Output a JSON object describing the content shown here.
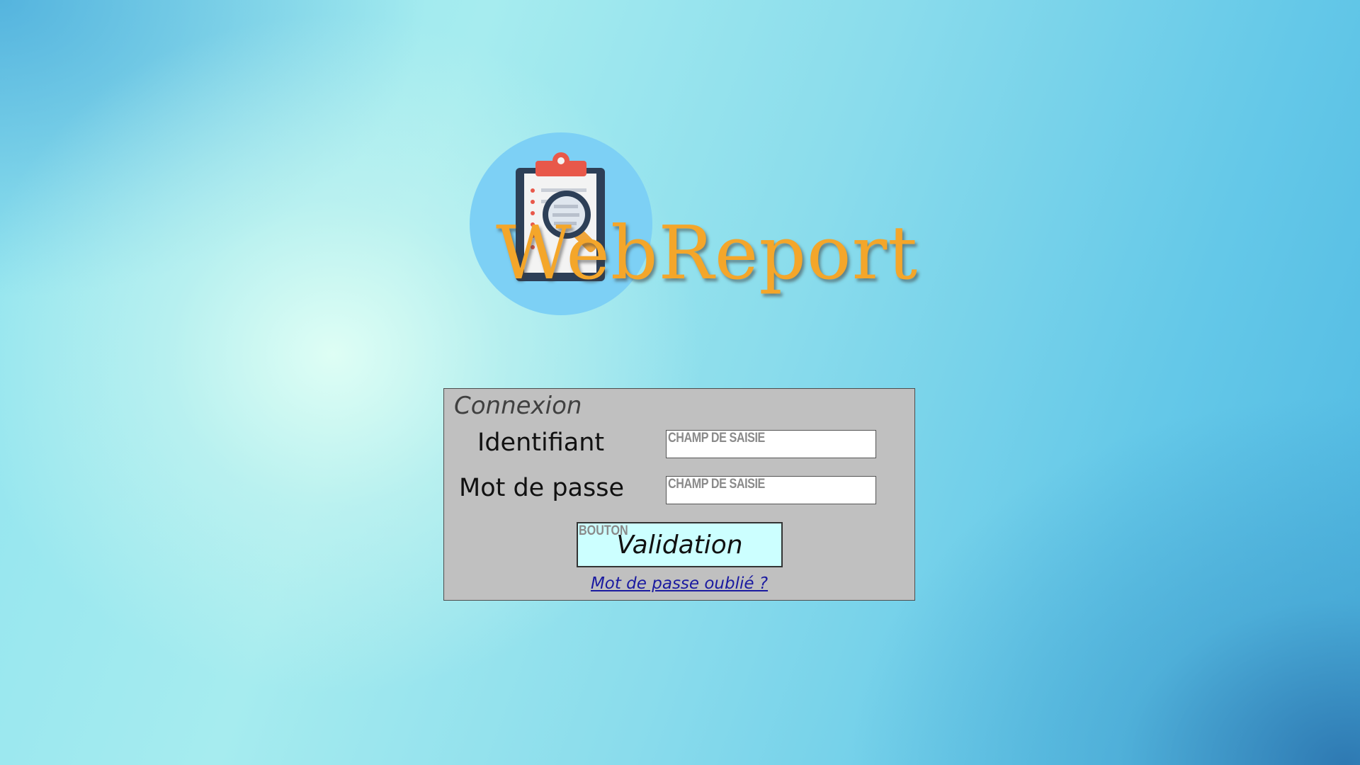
{
  "app": {
    "logo_text": "WebReport"
  },
  "login": {
    "title": "Connexion",
    "username_label": "Identifiant",
    "username_placeholder": "CHAMP DE SAISIE",
    "password_label": "Mot de passe",
    "password_placeholder": "CHAMP DE SAISIE",
    "submit_tag": "BOUTON",
    "submit_label": "Validation",
    "forgot_link": "Mot de passe oublié ?"
  },
  "icons": {
    "logo": "clipboard-magnifier-icon"
  },
  "colors": {
    "logo_text": "#f4a62a",
    "logo_circle": "#7dd0f5",
    "panel_bg": "#c0c0c0",
    "button_bg": "#ccffff",
    "link": "#1a1aa0"
  }
}
